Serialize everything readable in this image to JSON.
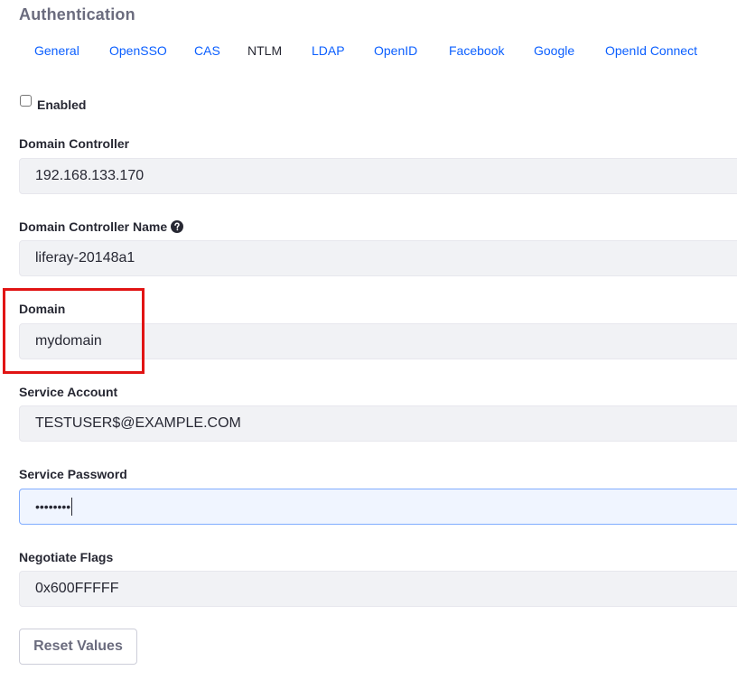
{
  "section": {
    "title": "Authentication"
  },
  "tabs": [
    {
      "label": "General",
      "active": false
    },
    {
      "label": "OpenSSO",
      "active": false
    },
    {
      "label": "CAS",
      "active": false
    },
    {
      "label": "NTLM",
      "active": true
    },
    {
      "label": "LDAP",
      "active": false
    },
    {
      "label": "OpenID",
      "active": false
    },
    {
      "label": "Facebook",
      "active": false
    },
    {
      "label": "Google",
      "active": false
    },
    {
      "label": "OpenId Connect",
      "active": false
    }
  ],
  "enabled": {
    "label": "Enabled",
    "checked": false
  },
  "fields": {
    "domain_controller": {
      "label": "Domain Controller",
      "value": "192.168.133.170"
    },
    "domain_controller_name": {
      "label": "Domain Controller Name",
      "value": "liferay-20148a1",
      "help_icon": "question-circle-icon"
    },
    "domain": {
      "label": "Domain",
      "value": "mydomain"
    },
    "service_account": {
      "label": "Service Account",
      "value": "TESTUSER$@EXAMPLE.COM"
    },
    "service_password": {
      "label": "Service Password",
      "value": "••••••••"
    },
    "negotiate_flags": {
      "label": "Negotiate Flags",
      "value": "0x600FFFFF"
    }
  },
  "actions": {
    "reset_label": "Reset Values"
  },
  "colors": {
    "link": "#0b5fff",
    "highlight": "#e11414",
    "input_bg": "#f1f2f5",
    "focused_border": "#80acff"
  }
}
